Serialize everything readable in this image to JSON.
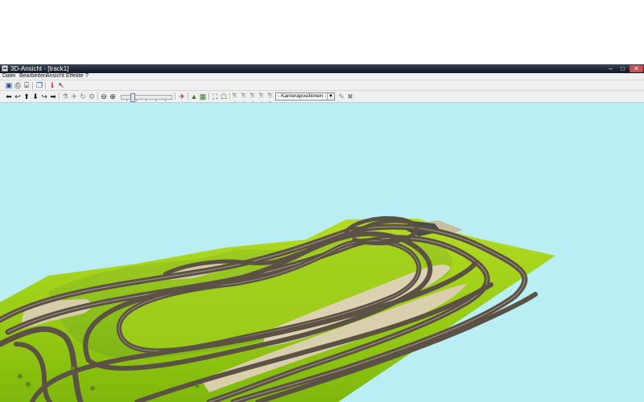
{
  "window": {
    "title": "3D-Ansicht - [track1]",
    "controls": {
      "minimize": "–",
      "maximize": "□",
      "close": "✕"
    }
  },
  "menu": [
    {
      "label": "Datei"
    },
    {
      "label": "Bearbeiten"
    },
    {
      "label": "Ansicht"
    },
    {
      "label": "Effekte"
    },
    {
      "label": "?"
    }
  ],
  "toolbar1": [
    {
      "name": "save-icon",
      "glyph": "▣"
    },
    {
      "name": "print-icon",
      "glyph": "⎙"
    },
    {
      "name": "print-preview-icon",
      "glyph": "⌸"
    },
    {
      "name": "copy-icon",
      "glyph": "❐"
    },
    {
      "name": "info-icon",
      "glyph": "ℹ"
    },
    {
      "name": "help-pointer-icon",
      "glyph": "↖"
    }
  ],
  "toolbar2": {
    "nav": [
      {
        "name": "move-left-icon",
        "glyph": "⬅"
      },
      {
        "name": "turn-left-icon",
        "glyph": "↩"
      },
      {
        "name": "move-forward-icon",
        "glyph": "⬆"
      },
      {
        "name": "move-back-icon",
        "glyph": "⬇"
      },
      {
        "name": "turn-right-icon",
        "glyph": "↪"
      },
      {
        "name": "move-right-icon",
        "glyph": "➡"
      }
    ],
    "view": [
      {
        "name": "walk-mode-icon",
        "glyph": "⚗"
      },
      {
        "name": "fly-mode-icon",
        "glyph": "✈"
      },
      {
        "name": "rotate-icon",
        "glyph": "↻"
      },
      {
        "name": "drive-icon",
        "glyph": "⚙"
      }
    ],
    "zoom": [
      {
        "name": "zoom-out-icon",
        "glyph": "⊖"
      },
      {
        "name": "zoom-in-icon",
        "glyph": "⊕"
      }
    ],
    "zoom_level": 0.2,
    "tools": [
      {
        "name": "train-icon",
        "glyph": "✈"
      },
      {
        "name": "terrain-icon",
        "glyph": "▲"
      },
      {
        "name": "texture-icon",
        "glyph": "▦"
      },
      {
        "name": "fit-view-icon",
        "glyph": "⛶"
      },
      {
        "name": "screenshot-icon",
        "glyph": "☖"
      }
    ],
    "camera_slots": [
      {
        "name": "camera-slot-1-icon",
        "label": "⛷1"
      },
      {
        "name": "camera-slot-2-icon",
        "label": "⛷2"
      },
      {
        "name": "camera-slot-3-icon",
        "label": "⛷3"
      },
      {
        "name": "camera-slot-4-icon",
        "label": "⛷4"
      },
      {
        "name": "camera-slot-5-icon",
        "label": "⛷5"
      }
    ],
    "camera_select": {
      "value": "- Kamerapositionen -"
    },
    "camera_actions": [
      {
        "name": "camera-set-icon",
        "glyph": "✎"
      },
      {
        "name": "camera-delete-icon",
        "glyph": "✖"
      }
    ]
  },
  "colors": {
    "sky": "#b8eef4",
    "grass": "#9ccf14",
    "track": "#5b5145",
    "rock": "#d9cfae",
    "title_bar": "#1e2633"
  }
}
